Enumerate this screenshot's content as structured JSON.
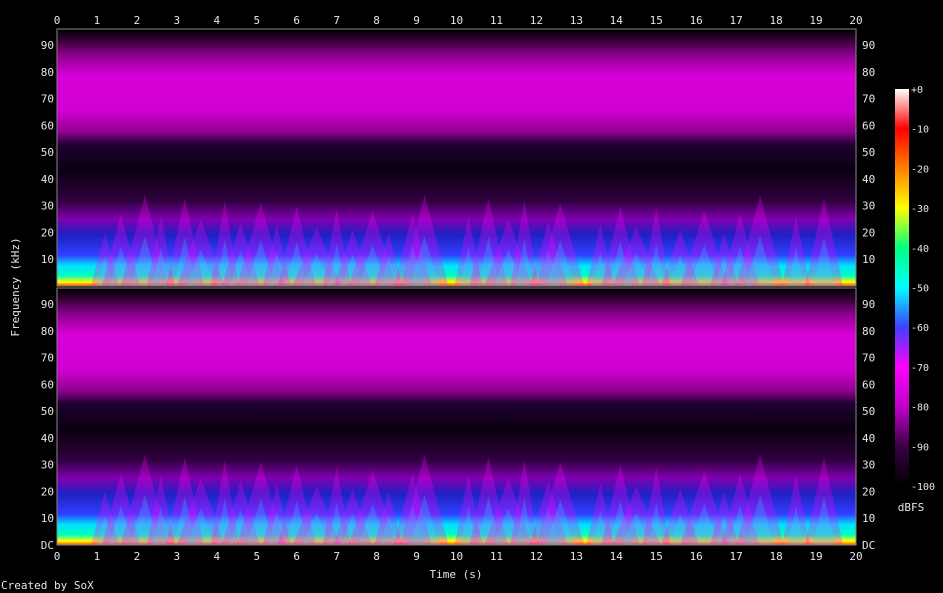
{
  "chart_data": {
    "type": "heatmap",
    "xlabel": "Time (s)",
    "ylabel": "Frequency (kHz)",
    "xlim": [
      0,
      20
    ],
    "x_ticks": [
      "0",
      "1",
      "2",
      "3",
      "4",
      "5",
      "6",
      "7",
      "8",
      "9",
      "10",
      "11",
      "12",
      "13",
      "14",
      "15",
      "16",
      "17",
      "18",
      "19",
      "20"
    ],
    "y_ticks_top": [
      "10",
      "20",
      "30",
      "40",
      "50",
      "60",
      "70",
      "80",
      "90"
    ],
    "y_ticks_bottom": [
      "DC",
      "10",
      "20",
      "30",
      "40",
      "50",
      "60",
      "70",
      "80",
      "90"
    ],
    "ylim_khz": [
      0,
      96
    ],
    "channels": 2,
    "colorbar": {
      "label": "dBFS",
      "ticks": [
        "+0",
        "-10",
        "-20",
        "-30",
        "-40",
        "-50",
        "-60",
        "-70",
        "-80",
        "-90",
        "-100"
      ],
      "range_dbfs": [
        -100,
        0
      ],
      "stops": [
        "#000000",
        "#3a0044",
        "#c000c8",
        "#ff00ff",
        "#4040ff",
        "#00ffff",
        "#00ff80",
        "#ffff00",
        "#ff8000",
        "#ff0000",
        "#ffffff"
      ]
    },
    "speech_energy_centers_s": [
      1.2,
      1.6,
      2.2,
      2.6,
      3.2,
      3.6,
      4.2,
      4.6,
      5.1,
      5.5,
      6.0,
      6.5,
      7.0,
      7.4,
      7.9,
      8.3,
      8.9,
      9.2,
      10.3,
      10.8,
      11.3,
      11.7,
      12.3,
      12.6,
      13.6,
      14.1,
      14.5,
      15.0,
      15.6,
      16.2,
      16.7,
      17.1,
      17.6,
      18.5,
      19.2
    ],
    "grid": false
  },
  "footer": {
    "credit": "Created by SoX"
  }
}
